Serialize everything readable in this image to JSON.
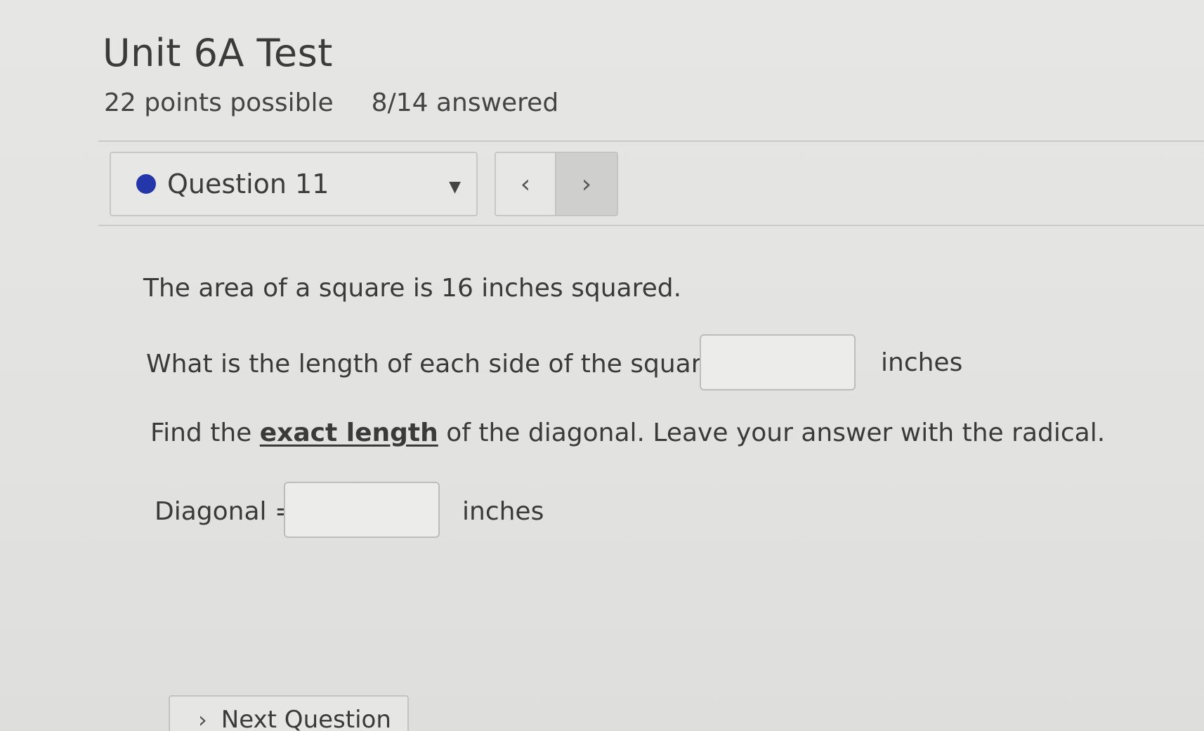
{
  "header": {
    "title": "Unit 6A Test",
    "points": "22 points possible",
    "answered": "8/14 answered"
  },
  "question_nav": {
    "selected": "Question 11",
    "status_color": "#2536a8",
    "caret_icon": "caret-down-icon",
    "prev_icon": "chevron-left-icon",
    "next_icon": "chevron-right-icon"
  },
  "question": {
    "statement": "The area of a square is 16 inches squared.",
    "part1_prompt": "What is the length of each side of the square?",
    "part1_value": "",
    "part1_unit": "inches",
    "part2_before": "Find the ",
    "part2_emphasis": "exact length",
    "part2_after": " of the diagonal.  Leave your answer with the radical.",
    "diagonal_label": "Diagonal =",
    "diagonal_value": "",
    "diagonal_unit": "inches"
  },
  "footer": {
    "next_label": "Next Question"
  }
}
